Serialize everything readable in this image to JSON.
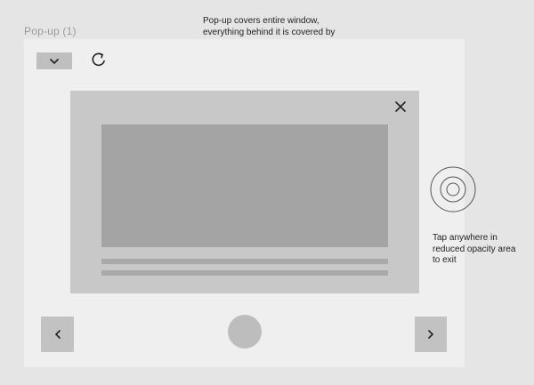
{
  "frame": {
    "label": "Pop-up (1)"
  },
  "annotations": {
    "top_note": "Pop-up covers entire window, everything behind it is covered by grey semi-transparent bg",
    "right_note": "Tap anywhere in reduced opacity area to exit"
  },
  "icons": {
    "dropdown": "chevron-down-icon",
    "refresh": "refresh-icon",
    "close": "close-icon",
    "prev": "chevron-left-icon",
    "next": "chevron-right-icon",
    "tap": "tap-target-icon"
  },
  "colors": {
    "background": "#e5e5e5",
    "frame": "#efefef",
    "modal": "#c8c8c8",
    "media_placeholder": "#a4a4a4",
    "button": "#c2c2c2",
    "icon_stroke": "#222222"
  }
}
